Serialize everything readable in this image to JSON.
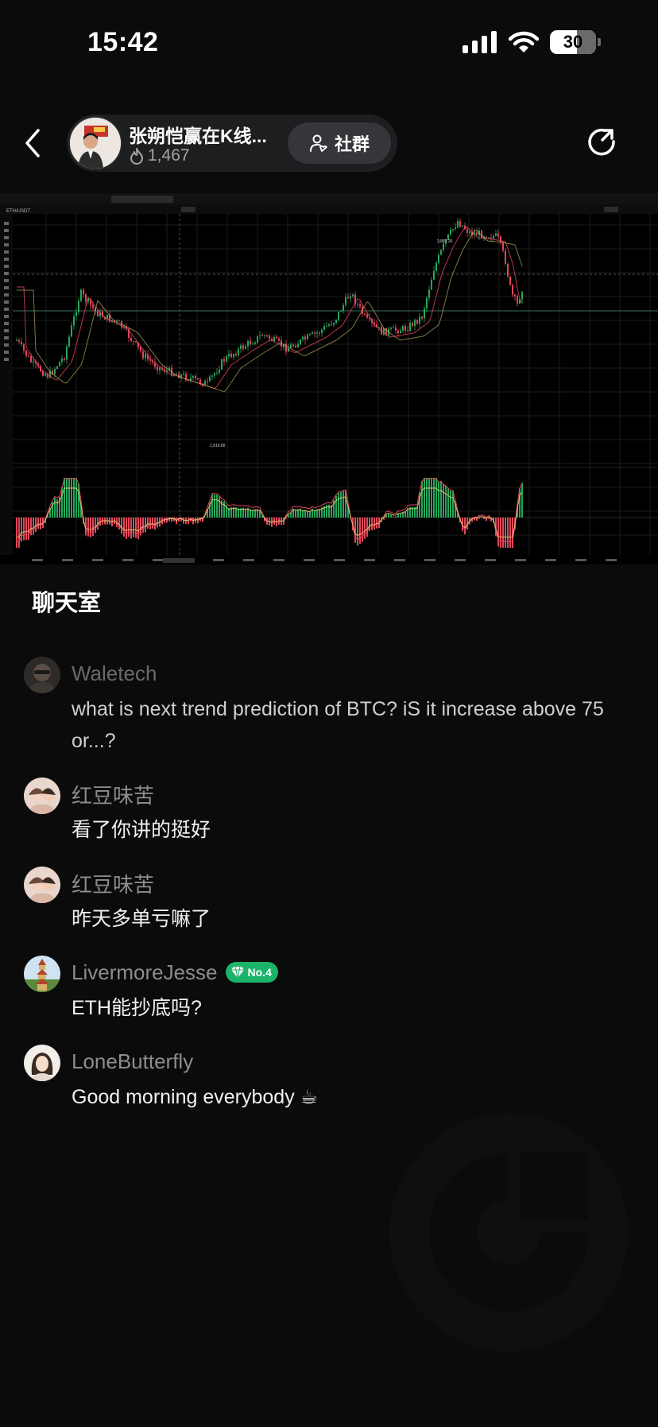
{
  "status_bar": {
    "time": "15:42",
    "battery": "30"
  },
  "header": {
    "host_name": "张朔恺赢在K线...",
    "hot_count": "1,467",
    "community_label": "社群"
  },
  "chart_screenshot": {
    "symbol": "ETH/USDT",
    "high_label": "3,887.26",
    "low_label": "1,910.00"
  },
  "chat": {
    "title": "聊天室",
    "messages": [
      {
        "name": "Waletech",
        "text": "what is next trend prediction of BTC? iS it increase above 75 or...?",
        "badge": ""
      },
      {
        "name": "红豆味苦",
        "text": "看了你讲的挺好",
        "badge": ""
      },
      {
        "name": "红豆味苦",
        "text": "昨天多单亏嘛了",
        "badge": ""
      },
      {
        "name": "LivermoreJesse",
        "text": "ETH能抄底吗?",
        "badge": "No.4"
      },
      {
        "name": "LoneButterfly",
        "text": "Good morning everybody ☕",
        "badge": ""
      }
    ]
  },
  "colors": {
    "background": "#0b0b0b",
    "pill": "#1d1e20",
    "badge_green": "#1bb36a",
    "candle_up": "#26a65b",
    "candle_down": "#e0475b"
  }
}
